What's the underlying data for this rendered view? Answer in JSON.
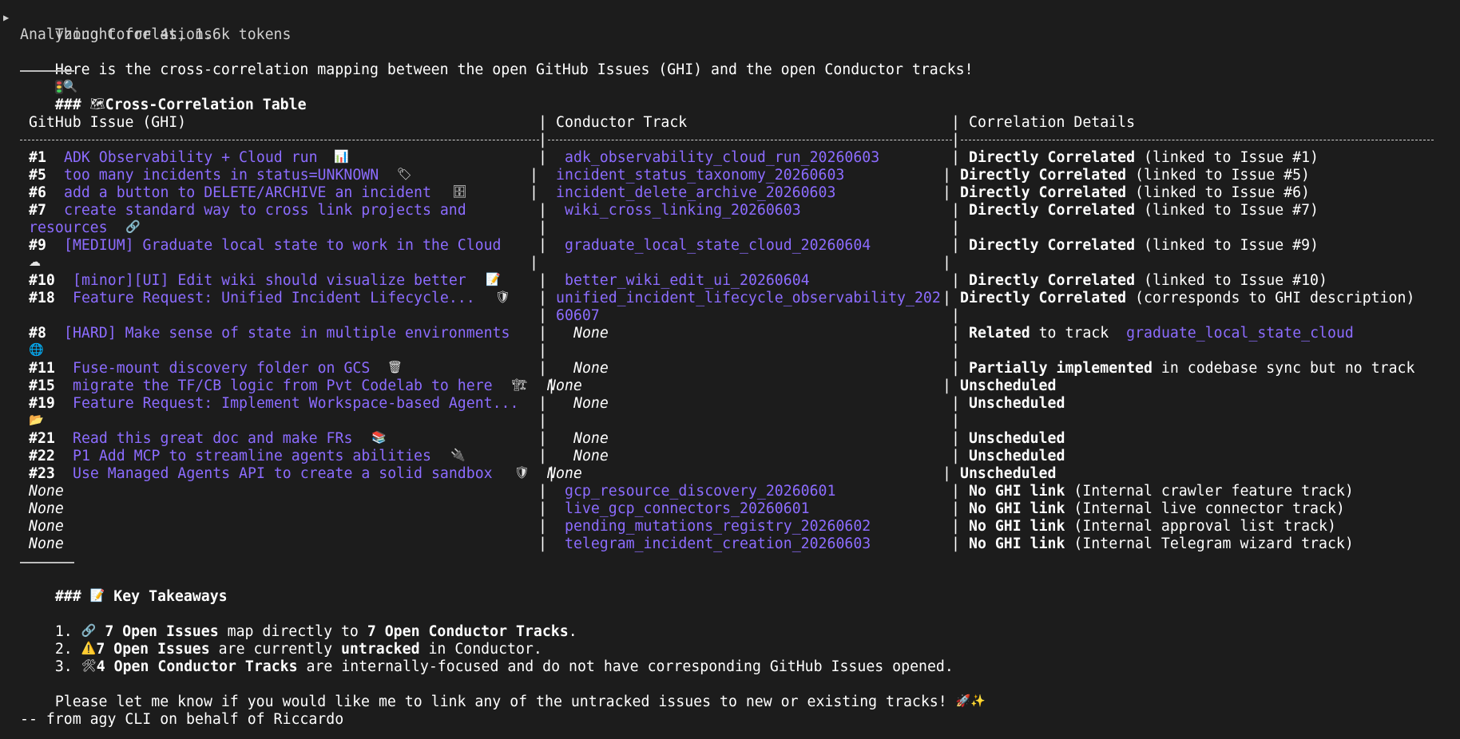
{
  "header": {
    "thought": "Thought for 4s, 1.6k tokens",
    "status": "Analyzing Correlations",
    "intro": "Here is the cross-correlation mapping between the open GitHub Issues (GHI) and the open Conductor tracks!"
  },
  "table_section": {
    "hashes": "###",
    "title": "Cross-Correlation Table",
    "columns": [
      "GitHub Issue (GHI)",
      "Conductor Track",
      "Correlation Details"
    ],
    "rows": [
      {
        "num": "#1",
        "title": "ADK Observability + Cloud run",
        "icon": "📊",
        "track": "adk_observability_cloud_run_20260603",
        "bold": "Directly Correlated",
        "rest": " (linked to Issue #1)"
      },
      {
        "num": "#5",
        "title": "too many incidents in status=UNKNOWN",
        "icon": "🏷",
        "track": "incident_status_taxonomy_20260603",
        "bold": "Directly Correlated",
        "rest": " (linked to Issue #5)"
      },
      {
        "num": "#6",
        "title": "add a button to DELETE/ARCHIVE an incident",
        "icon": "🗄",
        "track": "incident_delete_archive_20260603",
        "bold": "Directly Correlated",
        "rest": " (linked to Issue #6)"
      },
      {
        "num": "#7",
        "title": "create standard way to cross link projects and",
        "title_cont": "resources",
        "icon": "🔗",
        "track": "wiki_cross_linking_20260603",
        "bold": "Directly Correlated",
        "rest": " (linked to Issue #7)"
      },
      {
        "num": "#9",
        "title": "[MEDIUM] Graduate local state to work in the Cloud",
        "icon": "☁",
        "track": "graduate_local_state_cloud_20260604",
        "bold": "Directly Correlated",
        "rest": " (linked to Issue #9)"
      },
      {
        "num": "#10",
        "title": "[minor][UI] Edit wiki should visualize better",
        "icon": "📝",
        "track": "better_wiki_edit_ui_20260604",
        "bold": "Directly Correlated",
        "rest": " (linked to Issue #10)"
      },
      {
        "num": "#18",
        "title": "Feature Request: Unified Incident Lifecycle...",
        "icon": "🛡",
        "track": "unified_incident_lifecycle_observability_202",
        "track_cont": "60607",
        "bold": "Directly Correlated",
        "rest": " (corresponds to GHI description)"
      },
      {
        "num": "#8",
        "title": "[HARD] Make sense of state in multiple environments",
        "icon": "🌐",
        "track": "None",
        "bold": "Related",
        "rest": " to track ",
        "link": "graduate_local_state_cloud"
      },
      {
        "num": "#11",
        "title": "Fuse-mount discovery folder on GCS",
        "icon": "🗑",
        "track": "None",
        "bold": "Partially implemented",
        "rest": " in codebase sync but no track"
      },
      {
        "num": "#15",
        "title": "migrate the TF/CB logic from Pvt Codelab to here",
        "icon": "🏗",
        "track": "None",
        "bold": "Unscheduled",
        "rest": ""
      },
      {
        "num": "#19",
        "title": "Feature Request: Implement Workspace-based Agent...",
        "icon": "📂",
        "track": "None",
        "bold": "Unscheduled",
        "rest": ""
      },
      {
        "num": "#21",
        "title": "Read this great doc and make FRs",
        "icon": "📚",
        "track": "None",
        "bold": "Unscheduled",
        "rest": ""
      },
      {
        "num": "#22",
        "title": "P1 Add MCP to streamline agents abilities",
        "icon": "🔌",
        "track": "None",
        "bold": "Unscheduled",
        "rest": ""
      },
      {
        "num": "#23",
        "title": "Use Managed Agents API to create a solid sandbox",
        "icon": "🛡",
        "track": "None",
        "bold": "Unscheduled",
        "rest": ""
      },
      {
        "num": "None",
        "title": "",
        "icon": "",
        "track": "gcp_resource_discovery_20260601",
        "bold": "No GHI link",
        "rest": " (Internal crawler feature track)"
      },
      {
        "num": "None",
        "title": "",
        "icon": "",
        "track": "live_gcp_connectors_20260601",
        "bold": "No GHI link",
        "rest": " (Internal live connector track)"
      },
      {
        "num": "None",
        "title": "",
        "icon": "",
        "track": "pending_mutations_registry_20260602",
        "bold": "No GHI link",
        "rest": " (Internal approval list track)"
      },
      {
        "num": "None",
        "title": "",
        "icon": "",
        "track": "telegram_incident_creation_20260603",
        "bold": "No GHI link",
        "rest": " (Internal Telegram wizard track)"
      }
    ]
  },
  "takeaways": {
    "hashes": "###",
    "title": "Key Takeaways",
    "items": [
      {
        "n": "1.",
        "b1": "7 Open Issues",
        "t1": " map directly to ",
        "b2": "7 Open Conductor Tracks",
        "t2": "."
      },
      {
        "n": "2.",
        "b1": "7 Open Issues",
        "t1": " are currently ",
        "b2": "untracked",
        "t2": " in Conductor."
      },
      {
        "n": "3.",
        "b1": "4 Open Conductor Tracks",
        "t1": " are internally-focused and do not have corresponding GitHub Issues opened.",
        "b2": "",
        "t2": ""
      }
    ]
  },
  "closing": "Please let me know if you would like me to link any of the untracked issues to new or existing tracks!",
  "signature": "-- from agy CLI on behalf of Riccardo",
  "colors": {
    "background": "#1c1c1c",
    "text": "#e6e6e6",
    "accent_purple": "#8c6cff",
    "strong": "#ffffff"
  }
}
